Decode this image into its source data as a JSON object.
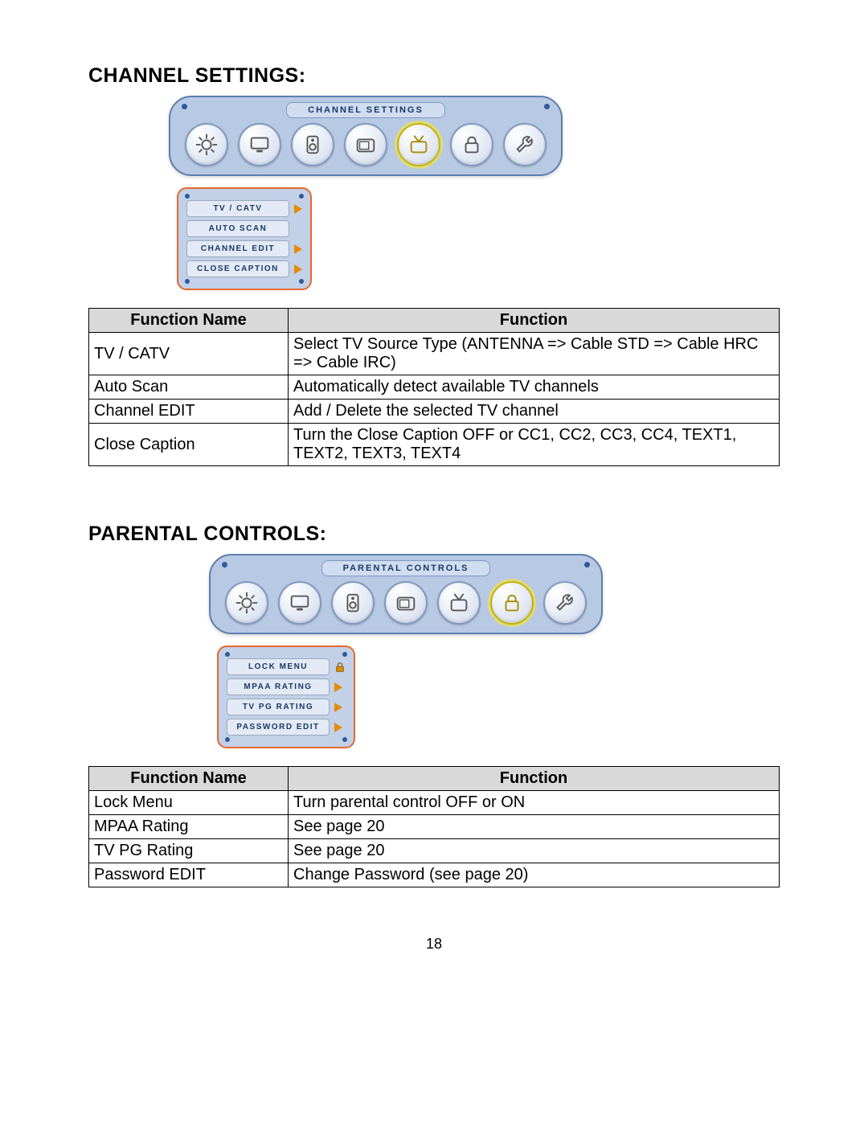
{
  "page_number": "18",
  "sections": [
    {
      "heading": "CHANNEL SETTINGS:",
      "osd_title": "CHANNEL  SETTINGS",
      "active_icon_index": 4,
      "submenu": [
        {
          "label": "TV / CATV",
          "indicator": "arrow"
        },
        {
          "label": "AUTO SCAN",
          "indicator": "none"
        },
        {
          "label": "CHANNEL EDIT",
          "indicator": "arrow"
        },
        {
          "label": "CLOSE CAPTION",
          "indicator": "arrow"
        }
      ],
      "table": {
        "headers": [
          "Function Name",
          "Function"
        ],
        "rows": [
          [
            "TV / CATV",
            "Select TV Source Type (ANTENNA => Cable STD => Cable HRC => Cable IRC)"
          ],
          [
            "Auto Scan",
            "Automatically detect available TV channels"
          ],
          [
            "Channel EDIT",
            "Add / Delete the selected TV channel"
          ],
          [
            "Close Caption",
            "Turn the Close Caption OFF or CC1, CC2, CC3, CC4, TEXT1, TEXT2, TEXT3, TEXT4"
          ]
        ]
      }
    },
    {
      "heading": "PARENTAL CONTROLS:",
      "osd_title": "PARENTAL  CONTROLS",
      "active_icon_index": 5,
      "submenu": [
        {
          "label": "LOCK MENU",
          "indicator": "lock"
        },
        {
          "label": "MPAA RATING",
          "indicator": "arrow"
        },
        {
          "label": "TV PG RATING",
          "indicator": "arrow"
        },
        {
          "label": "PASSWORD EDIT",
          "indicator": "arrow"
        }
      ],
      "table": {
        "headers": [
          "Function Name",
          "Function"
        ],
        "rows": [
          [
            "Lock Menu",
            "Turn parental control OFF or ON"
          ],
          [
            "MPAA Rating",
            "See page 20"
          ],
          [
            "TV PG Rating",
            "See page 20"
          ],
          [
            "Password EDIT",
            "Change Password (see page 20)"
          ]
        ]
      }
    }
  ],
  "icon_names": [
    "sun-burst-icon",
    "monitor-icon",
    "speaker-icon",
    "tv-icon",
    "antenna-tv-icon",
    "lock-icon",
    "wrench-icon"
  ]
}
